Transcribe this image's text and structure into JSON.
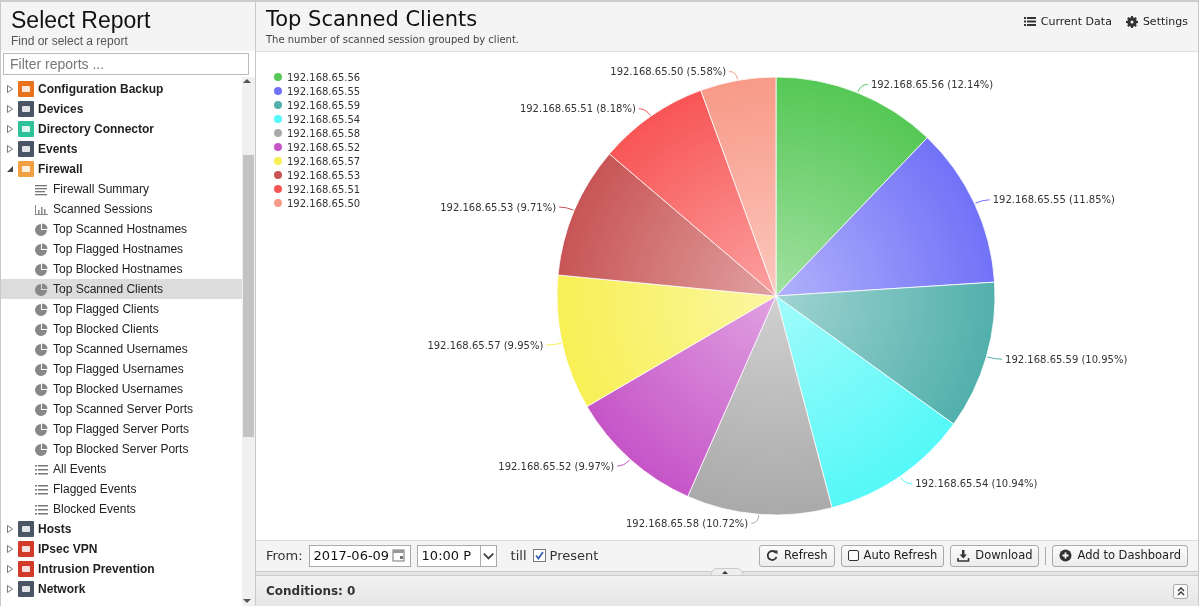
{
  "sidebar": {
    "title": "Select Report",
    "subtitle": "Find or select a report",
    "filter": {
      "placeholder": "Filter reports ..."
    },
    "tree": [
      {
        "label": "Configuration Backup",
        "expanded": false,
        "selected": false,
        "color": "#e8731c"
      },
      {
        "label": "Devices",
        "expanded": false,
        "selected": false,
        "color": "#4a5566"
      },
      {
        "label": "Directory Connector",
        "expanded": false,
        "selected": false,
        "color": "#2fc29a"
      },
      {
        "label": "Events",
        "expanded": false,
        "selected": false,
        "color": "#4a5566"
      },
      {
        "label": "Firewall",
        "expanded": true,
        "selected": false,
        "color": "#f0a040",
        "children": [
          {
            "label": "Firewall Summary",
            "kind": "text",
            "selected": false
          },
          {
            "label": "Scanned Sessions",
            "kind": "bar",
            "selected": false
          },
          {
            "label": "Top Scanned Hostnames",
            "kind": "pie",
            "selected": false
          },
          {
            "label": "Top Flagged Hostnames",
            "kind": "pie",
            "selected": false
          },
          {
            "label": "Top Blocked Hostnames",
            "kind": "pie",
            "selected": false
          },
          {
            "label": "Top Scanned Clients",
            "kind": "pie",
            "selected": true
          },
          {
            "label": "Top Flagged Clients",
            "kind": "pie",
            "selected": false
          },
          {
            "label": "Top Blocked Clients",
            "kind": "pie",
            "selected": false
          },
          {
            "label": "Top Scanned Usernames",
            "kind": "pie",
            "selected": false
          },
          {
            "label": "Top Flagged Usernames",
            "kind": "pie",
            "selected": false
          },
          {
            "label": "Top Blocked Usernames",
            "kind": "pie",
            "selected": false
          },
          {
            "label": "Top Scanned Server Ports",
            "kind": "pie",
            "selected": false
          },
          {
            "label": "Top Flagged Server Ports",
            "kind": "pie",
            "selected": false
          },
          {
            "label": "Top Blocked Server Ports",
            "kind": "pie",
            "selected": false
          },
          {
            "label": "All Events",
            "kind": "list",
            "selected": false
          },
          {
            "label": "Flagged Events",
            "kind": "list",
            "selected": false
          },
          {
            "label": "Blocked Events",
            "kind": "list",
            "selected": false
          }
        ]
      },
      {
        "label": "Hosts",
        "expanded": false,
        "selected": false,
        "color": "#4a5566"
      },
      {
        "label": "IPsec VPN",
        "expanded": false,
        "selected": false,
        "color": "#d23b2a"
      },
      {
        "label": "Intrusion Prevention",
        "expanded": false,
        "selected": false,
        "color": "#d23b2a"
      },
      {
        "label": "Network",
        "expanded": false,
        "selected": false,
        "color": "#4a5566"
      }
    ]
  },
  "main": {
    "title": "Top Scanned Clients",
    "subtitle": "The number of scanned session grouped by client.",
    "actions": [
      {
        "label": "Current Data",
        "kind": "data"
      },
      {
        "label": "Settings",
        "kind": "settings"
      }
    ],
    "chart_data": {
      "type": "pie",
      "legend": "top-left",
      "categories": [
        "192.168.65.56",
        "192.168.65.55",
        "192.168.65.59",
        "192.168.65.54",
        "192.168.65.58",
        "192.168.65.52",
        "192.168.65.57",
        "192.168.65.53",
        "192.168.65.51",
        "192.168.65.50"
      ],
      "values": [
        12.14,
        11.85,
        10.95,
        10.94,
        10.72,
        9.97,
        9.95,
        9.71,
        8.18,
        5.58
      ],
      "colors": [
        "#55c855",
        "#7272f8",
        "#52b0ac",
        "#55f8f8",
        "#aaaaaa",
        "#c655c8",
        "#f8f055",
        "#c85555",
        "#f85555",
        "#f89a88"
      ],
      "value_labels": [
        "192.168.65.56 (12.14%)",
        "192.168.65.55 (11.85%)",
        "192.168.65.59 (10.95%)",
        "192.168.65.54 (10.94%)",
        "192.168.65.58 (10.72%)",
        "192.168.65.52 (9.97%)",
        "192.168.65.57 (9.95%)",
        "192.168.65.53 (9.71%)",
        "192.168.65.51 (8.18%)",
        "192.168.65.50 (5.58%)"
      ]
    },
    "toolbar": {
      "from_label": "From:",
      "date": "2017-06-09",
      "time": "10:00 P",
      "till_label": "till",
      "present": {
        "label": "Present",
        "checked": true
      },
      "buttons": [
        {
          "label": "Refresh",
          "kind": "refresh"
        },
        {
          "label": "Auto Refresh",
          "kind": "toggle",
          "checked": false
        },
        {
          "label": "Download",
          "kind": "download"
        },
        {
          "label": "Add to Dashboard",
          "kind": "add"
        }
      ]
    },
    "conditions": {
      "label": "Conditions: 0"
    }
  }
}
